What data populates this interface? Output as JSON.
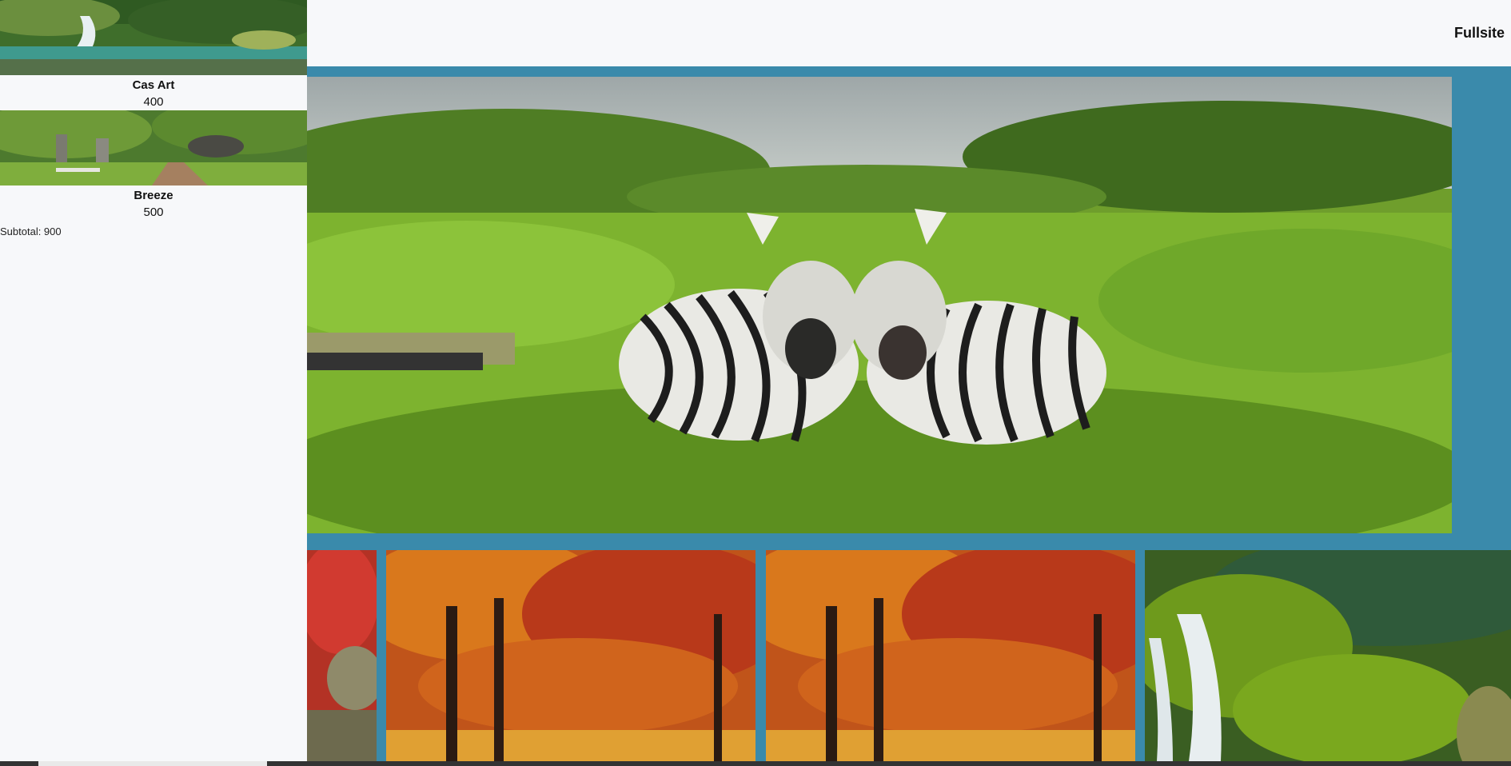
{
  "cart": {
    "items": [
      {
        "name": "Cas Art",
        "price": "400",
        "image": "waterfall-forest-image"
      },
      {
        "name": "Breeze",
        "price": "500",
        "image": "park-path-bench-image"
      }
    ],
    "subtotal": "Subtotal: 900"
  },
  "header": {
    "link_label": "Fullsite"
  },
  "gallery": {
    "hero_image": "zebras-in-grass-image",
    "thumbnails": [
      "red-autumn-trees-image",
      "autumn-forest-image",
      "autumn-forest-image",
      "mossy-waterfall-image"
    ]
  },
  "colors": {
    "accent": "#3a8aab",
    "background": "#f7f8fa"
  }
}
